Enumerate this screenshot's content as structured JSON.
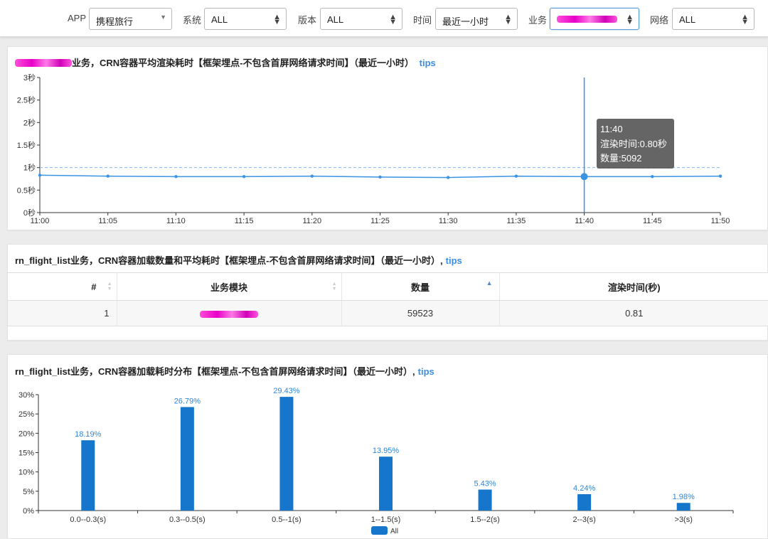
{
  "filters": {
    "app": {
      "label": "APP",
      "value": "携程旅行"
    },
    "system": {
      "label": "系统",
      "value": "ALL"
    },
    "version": {
      "label": "版本",
      "value": "ALL"
    },
    "time": {
      "label": "时间",
      "value": "最近一小时"
    },
    "business": {
      "label": "业务",
      "value": ""
    },
    "network": {
      "label": "网络",
      "value": "ALL"
    }
  },
  "panel1": {
    "title": "业务，CRN容器平均渲染耗时【框架埋点-不包含首屏网络请求时间】（最近一小时）",
    "tips": "tips",
    "tooltip": {
      "time": "11:40",
      "render_line": "渲染时间:0.80秒",
      "count_line": "数量:5092"
    }
  },
  "panel2": {
    "title": "rn_flight_list业务，CRN容器加载数量和平均耗时【框架埋点-不包含首屏网络请求时间】（最近一小时）,",
    "tips": "tips",
    "columns": [
      "#",
      "业务模块",
      "数量",
      "渲染时间(秒)"
    ],
    "rows": [
      {
        "index": "1",
        "module": "",
        "count": "59523",
        "render_time": "0.81"
      }
    ]
  },
  "panel3": {
    "title": "rn_flight_list业务，CRN容器加载耗时分布【框架埋点-不包含首屏网络请求时间】（最近一小时）,",
    "tips": "tips"
  },
  "colors": {
    "line": "#3b93e4",
    "bar": "#1576cc",
    "link": "#3a8ee6",
    "redaction": "#ee22cc"
  },
  "chart_data": [
    {
      "type": "line",
      "x": [
        "11:00",
        "11:05",
        "11:10",
        "11:15",
        "11:20",
        "11:25",
        "11:30",
        "11:35",
        "11:40",
        "11:45",
        "11:50"
      ],
      "values": [
        0.83,
        0.81,
        0.8,
        0.8,
        0.81,
        0.79,
        0.78,
        0.81,
        0.8,
        0.8,
        0.81
      ],
      "yticks": [
        "0秒",
        "0.5秒",
        "1秒",
        "1.5秒",
        "2秒",
        "2.5秒",
        "3秒"
      ],
      "ylim": [
        0,
        3
      ],
      "reference_line": 1,
      "highlight_x": "11:40"
    },
    {
      "type": "bar",
      "categories": [
        "0.0--0.3(s)",
        "0.3--0.5(s)",
        "0.5--1(s)",
        "1--1.5(s)",
        "1.5--2(s)",
        "2--3(s)",
        ">3(s)"
      ],
      "values": [
        18.19,
        26.79,
        29.43,
        13.95,
        5.43,
        4.24,
        1.98
      ],
      "data_labels": [
        "18.19%",
        "26.79%",
        "29.43%",
        "13.95%",
        "5.43%",
        "4.24%",
        "1.98%"
      ],
      "yticks": [
        "0%",
        "5%",
        "10%",
        "15%",
        "20%",
        "25%",
        "30%"
      ],
      "ylim": [
        0,
        30
      ],
      "series": [
        {
          "name": "All",
          "values": [
            18.19,
            26.79,
            29.43,
            13.95,
            5.43,
            4.24,
            1.98
          ]
        }
      ],
      "legend": "bottom-center"
    }
  ]
}
